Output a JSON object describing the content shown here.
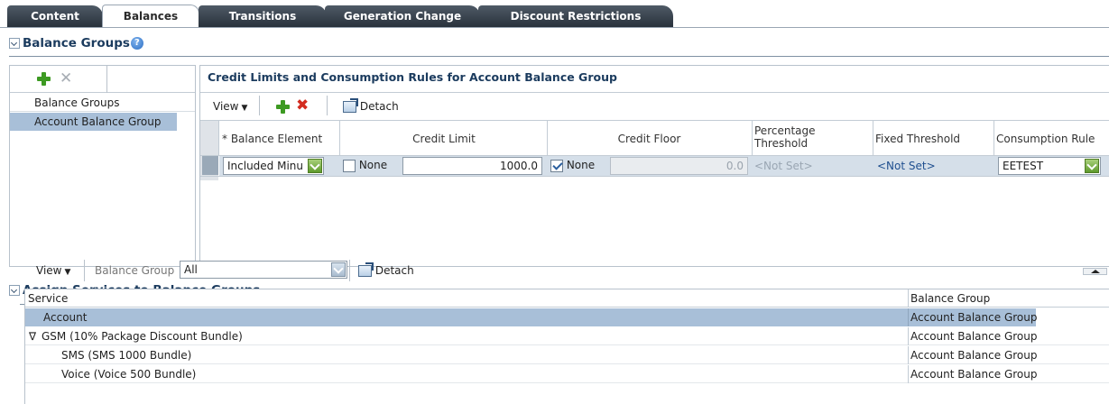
{
  "tabs": [
    {
      "label": "Content",
      "active": false
    },
    {
      "label": "Balances",
      "active": true
    },
    {
      "label": "Transitions",
      "active": false
    },
    {
      "label": "Generation Change",
      "active": false
    },
    {
      "label": "Discount Restrictions",
      "active": false
    }
  ],
  "balance_groups": {
    "title": "Balance Groups",
    "help_icon": "?",
    "list": [
      "Balance Groups",
      "Account Balance Group"
    ],
    "selected_list_item": "Account Balance Group"
  },
  "credit_limits": {
    "title": "Credit Limits and Consumption Rules for Account Balance Group",
    "view_label": "View",
    "detach_label": "Detach",
    "columns": {
      "balance_element": "* Balance Element",
      "credit_limit": "Credit Limit",
      "credit_floor": "Credit Floor",
      "percentage_threshold": "Percentage Threshold",
      "fixed_threshold": "Fixed Threshold",
      "consumption_rule": "Consumption Rule"
    },
    "row": {
      "balance_element": "Included Minu",
      "credit_limit_none_label": "None",
      "credit_limit_none_checked": false,
      "credit_limit_value": "1000.0",
      "credit_floor_none_label": "None",
      "credit_floor_none_checked": true,
      "credit_floor_value": "0.0",
      "percentage_threshold": "<Not Set>",
      "fixed_threshold": "<Not Set>",
      "consumption_rule": "EETEST"
    }
  },
  "assign_services": {
    "title": "Assign Services to Balance Groups",
    "view_label": "View",
    "balance_group_label": "Balance Group",
    "balance_group_value": "All",
    "detach_label": "Detach",
    "columns": {
      "service": "Service",
      "balance_group": "Balance Group"
    },
    "rows": [
      {
        "service": "Account",
        "balance_group": "Account Balance Group",
        "selected": true
      },
      {
        "service": "GSM (10% Package Discount Bundle)",
        "balance_group": "Account Balance Group",
        "expanded": true
      },
      {
        "service": "SMS (SMS 1000 Bundle)",
        "balance_group": "Account Balance Group"
      },
      {
        "service": "Voice (Voice 500 Bundle)",
        "balance_group": "Account Balance Group"
      }
    ],
    "expand_glyph": "∇"
  },
  "colors": {
    "selected_row": "#a8bfd8",
    "header_text": "#1b3b5e",
    "link_text": "#1f4f8f",
    "tab_dark": "#2f3842"
  }
}
